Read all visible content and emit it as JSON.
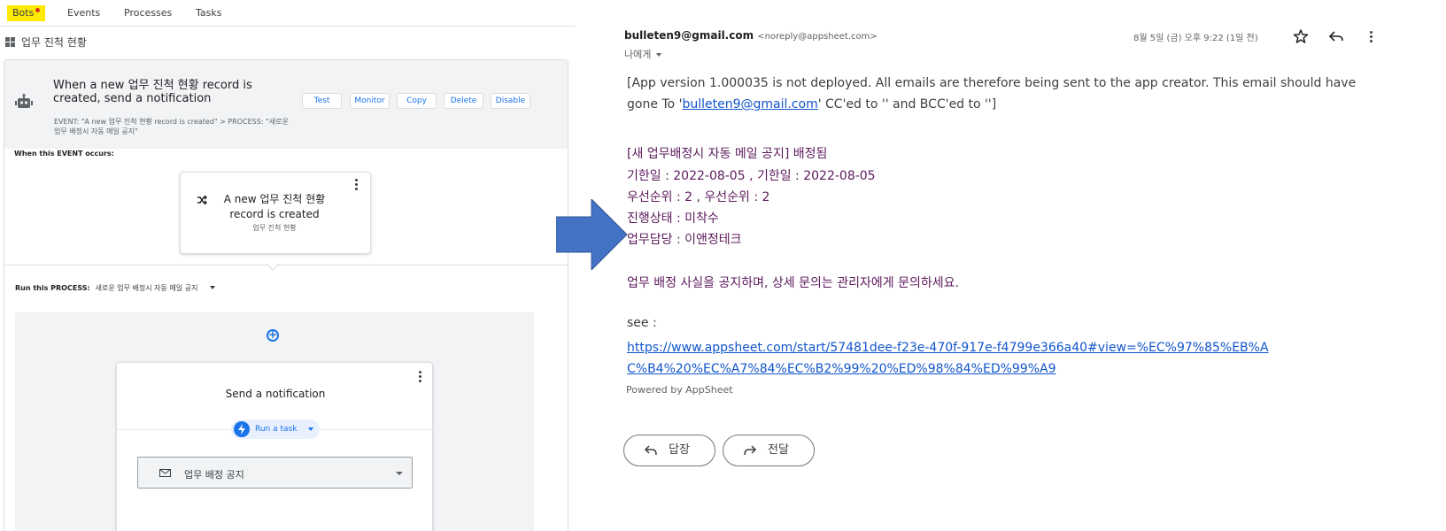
{
  "left": {
    "tabs": [
      {
        "label": "Bots",
        "active": true,
        "has_dot": true
      },
      {
        "label": "Events"
      },
      {
        "label": "Processes"
      },
      {
        "label": "Tasks"
      }
    ],
    "breadcrumb": "업무 진척 현황",
    "bot": {
      "title": "When a new 업무 진척 현황 record is created, send a notification",
      "subtitle": "EVENT: \"A new 업무 진척 현황 record is created\" > PROCESS: \"새로운 업무 배정시 자동 메일 공지\"",
      "actions": [
        "Test",
        "Monitor",
        "Copy",
        "Delete",
        "Disable"
      ]
    },
    "event_section_label": "When this EVENT occurs:",
    "event_card": {
      "title": "A new 업무 진척 현황 record is created",
      "subtitle": "업무 진척 현황"
    },
    "process_label": "Run this PROCESS:",
    "process_value": "새로운 업무 배정시 자동 메일 공지",
    "step": {
      "title": "Send a notification",
      "pill_label": "Run a task",
      "select_value": "업무 배정 공지"
    }
  },
  "email": {
    "sender_name": "bulleten9@gmail.com",
    "sender_addr": "<noreply@appsheet.com>",
    "to_me": "나에게",
    "date": "8월 5일 (금) 오후 9:22 (1일 전)",
    "notice_pre": "[App version 1.000035 is not deployed. All emails are therefore being sent to the app creator. This email should have gone To '",
    "notice_link": "bulleten9@gmail.com",
    "notice_post": "' CC'ed to '' and BCC'ed to '']",
    "lines": [
      "[새 업무배정시 자동 메일 공지] 배정됨",
      "기한일 : 2022-08-05 , 기한일 : 2022-08-05",
      "우선순위 : 2 , 우선순위 : 2",
      "진행상태 : 미착수",
      "업무담당 : 이앤정테크"
    ],
    "notice_message": "업무 배정 사실을 공지하며, 상세 문의는 관리자에게 문의하세요.",
    "see_label": "see :",
    "url": "https://www.appsheet.com/start/57481dee-f23e-470f-917e-f4799e366a40#view=%EC%97%85%EB%AC%B4%20%EC%A7%84%EC%B2%99%20%ED%98%84%ED%99%A9",
    "powered_by": "Powered by AppSheet",
    "reply_label": "답장",
    "forward_label": "전달"
  },
  "colors": {
    "accent_blue": "#1a73e8",
    "arrow_blue": "#4472c4",
    "email_purple": "#5c1a5c",
    "link_blue": "#1155cc",
    "tab_highlight": "#ffeb00"
  },
  "icons": [
    "grid-icon",
    "robot-icon",
    "shuffle-icon",
    "more-vert-icon",
    "add-circle-icon",
    "bolt-icon",
    "mail-icon",
    "star-icon",
    "reply-icon",
    "forward-icon",
    "arrow-right-icon"
  ]
}
